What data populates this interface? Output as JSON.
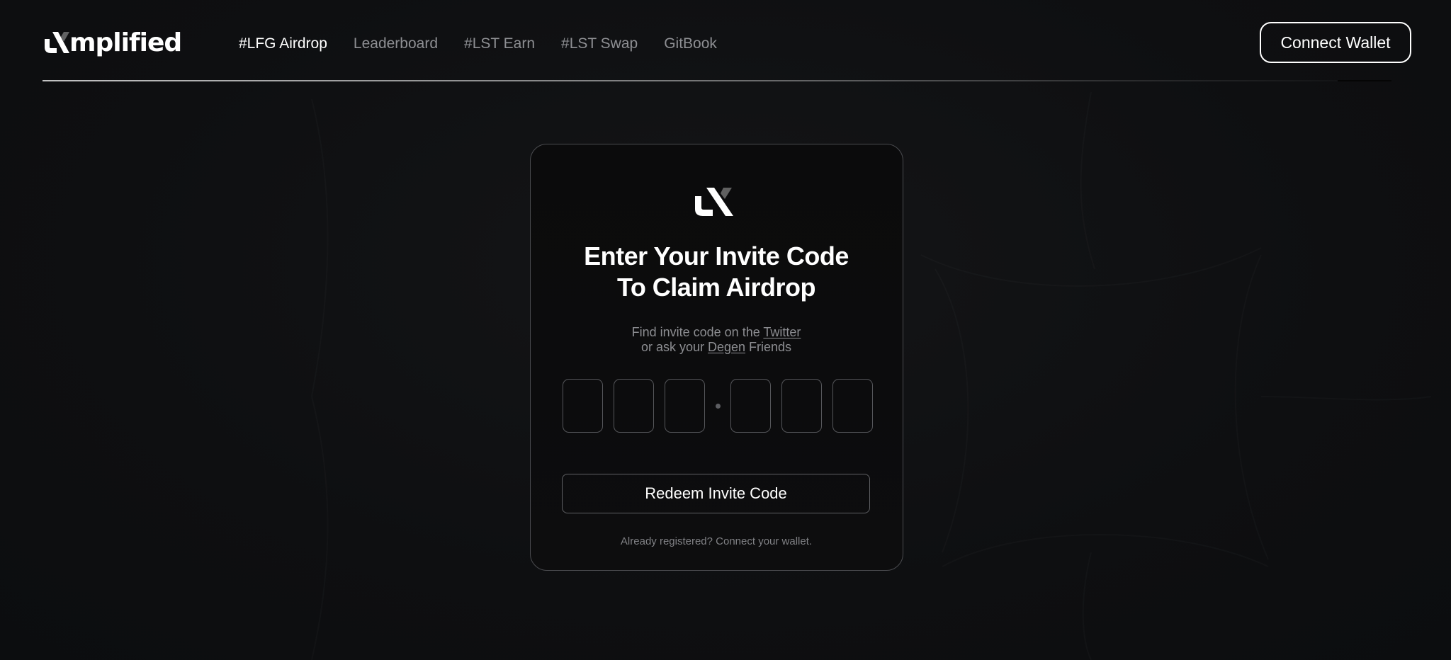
{
  "brand": {
    "name": "mplified"
  },
  "nav": {
    "items": [
      {
        "label": "#LFG Airdrop",
        "active": true
      },
      {
        "label": "Leaderboard",
        "active": false
      },
      {
        "label": "#LST Earn",
        "active": false
      },
      {
        "label": "#LST Swap",
        "active": false
      },
      {
        "label": "GitBook",
        "active": false
      }
    ]
  },
  "header": {
    "connect_label": "Connect Wallet"
  },
  "card": {
    "title_line1": "Enter Your Invite Code",
    "title_line2": "To Claim Airdrop",
    "sub_line1_prefix": "Find invite code on the ",
    "sub_line1_link": "Twitter",
    "sub_line2_prefix": "or ask your ",
    "sub_line2_link": "Degen",
    "sub_line2_suffix": " Friends",
    "code": [
      "",
      "",
      "",
      "",
      "",
      ""
    ],
    "redeem_label": "Redeem Invite Code",
    "footer_text": "Already registered? Connect your wallet."
  },
  "colors": {
    "background": "#0f1012",
    "card": "#0b0b0c",
    "text": "#ffffff",
    "muted": "#8d8e92",
    "border": "#55565a"
  },
  "icons": {
    "brand": "amplified-logo-icon"
  }
}
